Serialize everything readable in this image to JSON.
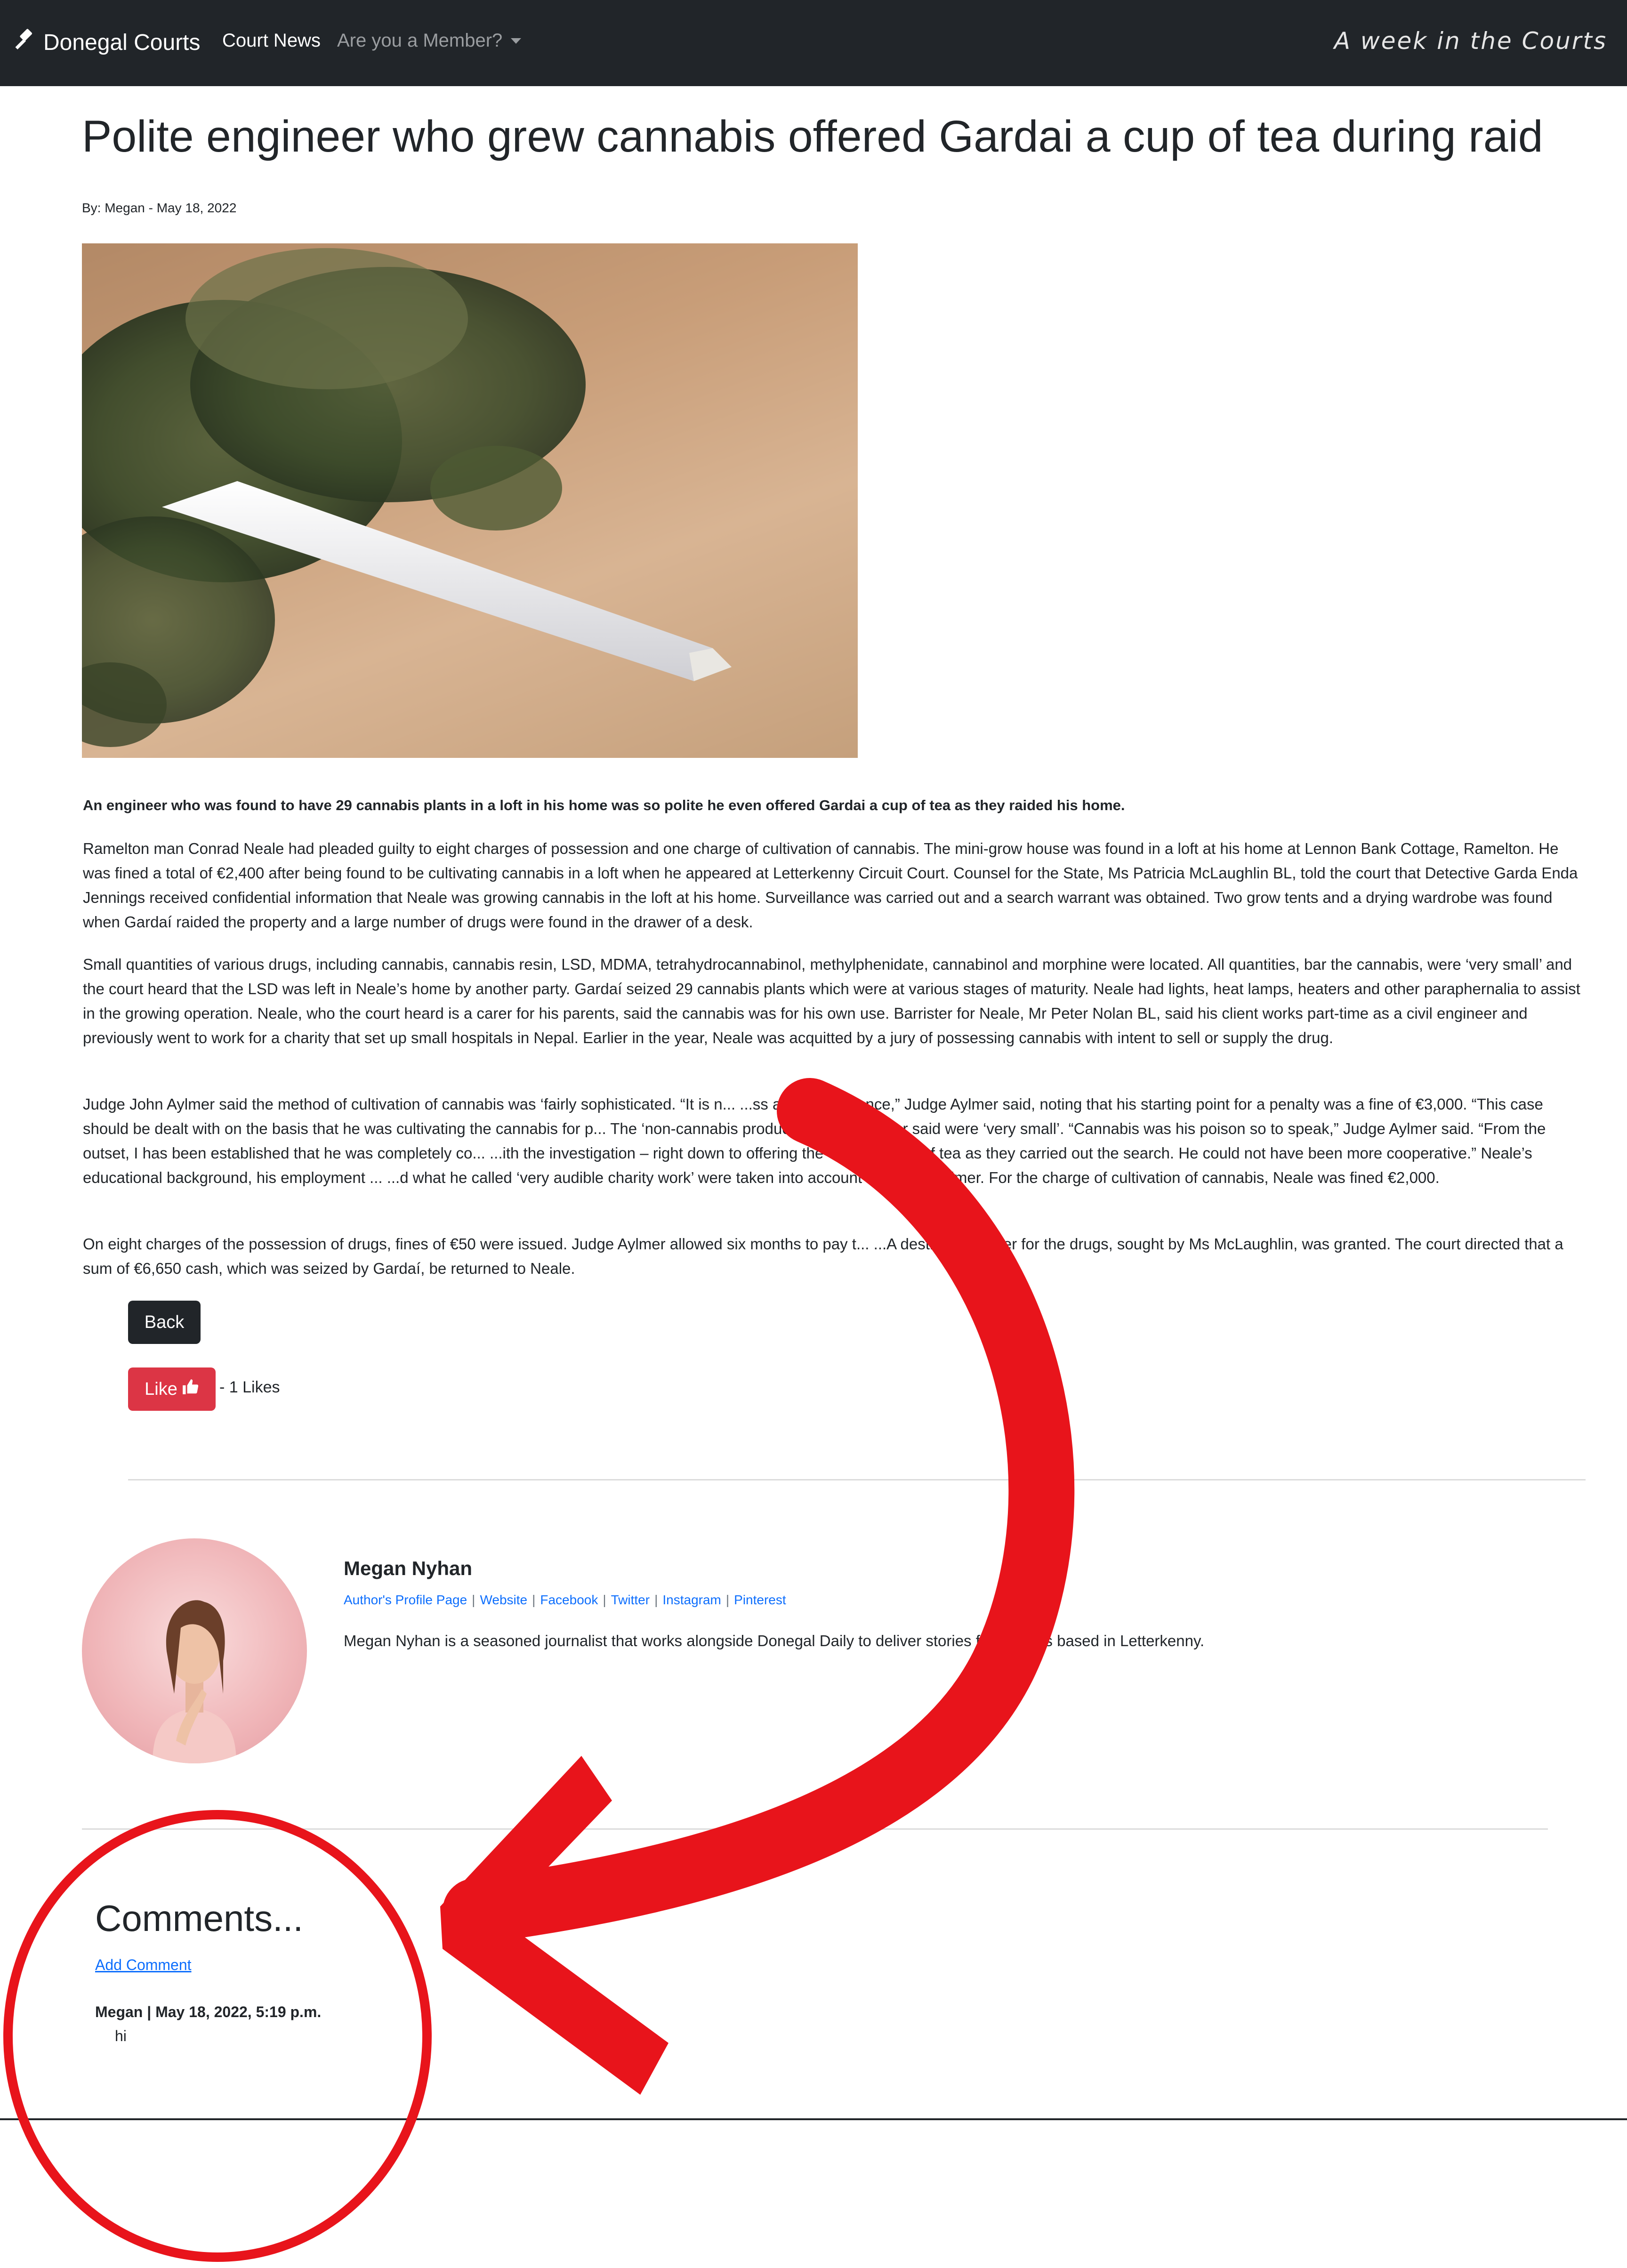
{
  "navbar": {
    "brand": "Donegal Courts",
    "court_news": "Court News",
    "member_menu": "Are you a Member?",
    "tagline": "A week in the Courts"
  },
  "article": {
    "title": "Polite engineer who grew cannabis offered Gardai a cup of tea during raid",
    "byline": "By: Megan - May 18, 2022",
    "lead": "An engineer who was found to have 29 cannabis plants in a loft in his home was so polite he even offered Gardai a cup of tea as they raided his home.",
    "paragraphs": [
      "Ramelton man Conrad Neale had pleaded guilty to eight charges of possession and one charge of cultivation of cannabis. The mini-grow house was found in a loft at his home at Lennon Bank Cottage, Ramelton. He was fined a total of €2,400 after being found to be cultivating cannabis in a loft when he appeared at Letterkenny Circuit Court. Counsel for the State, Ms Patricia McLaughlin BL, told the court that Detective Garda Enda Jennings received confidential information that Neale was growing cannabis in the loft at his home. Surveillance was carried out and a search warrant was obtained. Two grow tents and a drying wardrobe was found when Gardaí raided the property and a large number of drugs were found in the drawer of a desk.",
      "Small quantities of various drugs, including cannabis, cannabis resin, LSD, MDMA, tetrahydrocannabinol, methylphenidate, cannabinol and morphine were located. All quantities, bar the cannabis, were ‘very small’ and the court heard that the LSD was left in Neale’s home by another party. Gardaí seized 29 cannabis plants which were at various stages of maturity. Neale had lights, heat lamps, heaters and other paraphernalia to assist in the growing operation. Neale, who the court heard is a carer for his parents, said the cannabis was for his own use. Barrister for Neale, Mr Peter Nolan BL, said his client works part-time as a civil engineer and previously went to work for a charity that set up small hospitals in Nepal. Earlier in the year, Neale was acquitted by a jury of possessing cannabis with intent to sell or supply the drug.",
      "Judge John Aylmer said the method of cultivation of cannabis was ‘fairly sophisticated. “It is n... ...ss a serious offence,” Judge Aylmer said, noting that his starting point for a penalty was a fine of €3,000. “This case should be dealt with on the basis that he was cultivating the cannabis for p... The ‘non-cannabis products’, Judge Aylmer said were ‘very small’. “Cannabis was his poison so to speak,” Judge Aylmer said. “From the outset, I has been established that he was completely co... ...ith the investigation – right down to offering the Gardaí a cup of tea as they carried out the search. He could not have been more cooperative.” Neale’s educational background, his employment ... ...d what he called ‘very audible charity work’ were taken into account by Judge Aylmer. For the charge of cultivation of cannabis, Neale was fined €2,000.",
      "On eight charges of the possession of drugs, fines of €50 were issued. Judge Aylmer allowed six months to pay t... ...A destruction order for the drugs, sought by Ms McLaughlin, was granted. The court directed that a sum of €6,650 cash, which was seized by Gardaí, be returned to Neale."
    ]
  },
  "actions": {
    "back": "Back",
    "like": "Like",
    "likes_count": "- 1 Likes"
  },
  "author": {
    "name": "Megan Nyhan",
    "links": [
      "Author's Profile Page",
      "Website",
      "Facebook",
      "Twitter",
      "Instagram",
      "Pinterest"
    ],
    "separator": "|",
    "bio": "Megan Nyhan is a seasoned journalist that works alongside Donegal Daily to deliver stories f... ...courts based in Letterkenny."
  },
  "comments": {
    "title": "Comments...",
    "add_link": "Add Comment",
    "items": [
      {
        "meta": "Megan | May 18, 2022, 5:19 p.m.",
        "text": "hi"
      }
    ]
  },
  "colors": {
    "navbar_bg": "#212529",
    "like_button": "#dc3545",
    "link": "#0d6efd",
    "annotation_red": "#e8141b"
  },
  "icons": [
    "gavel-icon",
    "caret-down-icon",
    "thumbs-up-icon"
  ]
}
